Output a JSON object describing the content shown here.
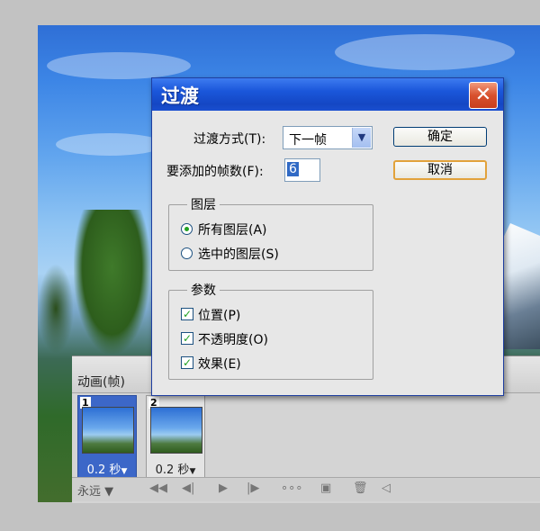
{
  "dialog": {
    "title": "过渡",
    "tween_with_label": "过渡方式(T):",
    "tween_with_value": "下一帧",
    "frames_to_add_label": "要添加的帧数(F):",
    "frames_to_add_value": "6",
    "ok_label": "确定",
    "cancel_label": "取消",
    "layers_group": {
      "title": "图层",
      "options": [
        {
          "label": "所有图层(A)",
          "selected": true
        },
        {
          "label": "选中的图层(S)",
          "selected": false
        }
      ]
    },
    "params_group": {
      "title": "参数",
      "options": [
        {
          "label": "位置(P)",
          "checked": true
        },
        {
          "label": "不透明度(O)",
          "checked": true
        },
        {
          "label": "效果(E)",
          "checked": true
        }
      ]
    }
  },
  "animation_panel": {
    "title": "动画(帧)",
    "frames": [
      {
        "number": "1",
        "delay": "0.2 秒",
        "selected": true
      },
      {
        "number": "2",
        "delay": "0.2 秒",
        "selected": false
      }
    ],
    "loop_value": "永远",
    "toolbar_icons": [
      "first-frame-icon",
      "prev-frame-icon",
      "play-icon",
      "next-frame-icon",
      "tween-icon",
      "new-frame-icon",
      "delete-frame-icon"
    ]
  },
  "colors": {
    "titlebar": "#1a56da",
    "close_button": "#d8512e",
    "selected_frame": "#3c67c8",
    "check_mark": "#21a121",
    "default_button_border": "#e2a23a"
  }
}
